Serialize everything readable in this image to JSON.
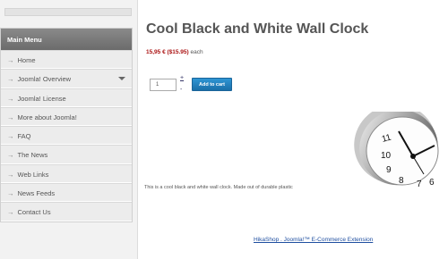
{
  "sidebar": {
    "menu_title": "Main Menu",
    "items": [
      {
        "label": "Home"
      },
      {
        "label": "Joomla! Overview",
        "has_submenu": true
      },
      {
        "label": "Joomla! License"
      },
      {
        "label": "More about Joomla!"
      },
      {
        "label": "FAQ"
      },
      {
        "label": "The News"
      },
      {
        "label": "Web Links"
      },
      {
        "label": "News Feeds"
      },
      {
        "label": "Contact Us"
      }
    ],
    "arrow_glyph": "→"
  },
  "product": {
    "title": "Cool Black and White Wall Clock",
    "price": "15,95 € ($15.95)",
    "price_unit": "each",
    "quantity": "1",
    "stepper_plus": "+",
    "stepper_minus": "-",
    "add_to_cart_label": "Add to cart",
    "description": "This is a cool black and white wall clock. Made out of durable plastic"
  },
  "footer": {
    "link": "HikaShop . Joomla!™ E-Commerce Extension"
  },
  "colors": {
    "price": "#aa1111",
    "button": "#2180c0",
    "menu_header": "#7a7a7a",
    "link": "#1f4fa0"
  }
}
